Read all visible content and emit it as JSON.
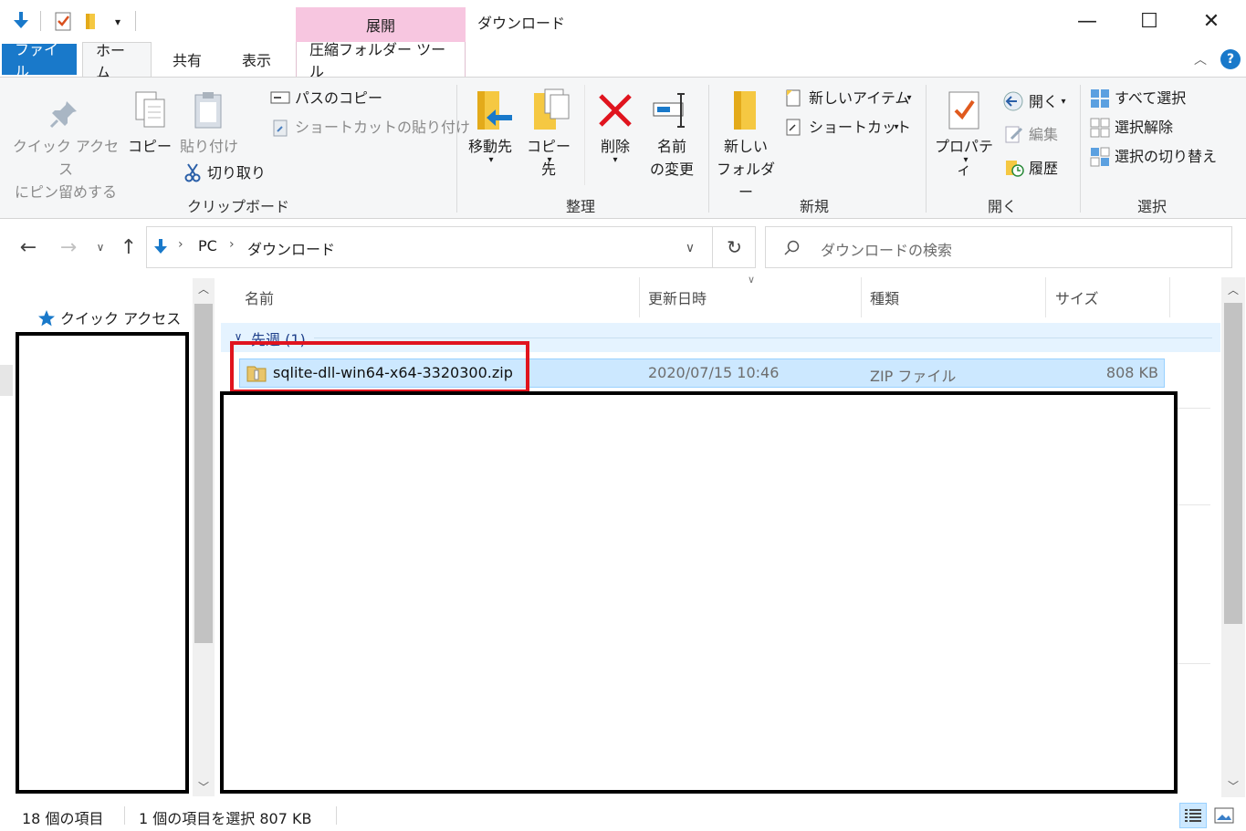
{
  "window": {
    "title": "ダウンロード",
    "context_group": "展開",
    "controls": {
      "minimize": "—",
      "maximize": "☐",
      "close": "✕"
    }
  },
  "tabs": {
    "file": "ファイル",
    "home": "ホーム",
    "share": "共有",
    "view": "表示",
    "extract": "圧縮フォルダー ツール"
  },
  "ribbon": {
    "clipboard": {
      "pin": "クイック アクセス\nにピン留めする",
      "copy": "コピー",
      "paste": "貼り付け",
      "copy_path": "パスのコピー",
      "paste_shortcut": "ショートカットの貼り付け",
      "cut": "切り取り",
      "label": "クリップボード"
    },
    "organize": {
      "move_to": "移動先",
      "copy_to": "コピー先",
      "delete": "削除",
      "rename": "名前\nの変更",
      "label": "整理"
    },
    "new": {
      "new_folder": "新しい\nフォルダー",
      "new_item": "新しいアイテム",
      "easy_access": "ショートカット",
      "label": "新規"
    },
    "open": {
      "properties": "プロパティ",
      "open": "開く",
      "edit": "編集",
      "history": "履歴",
      "label": "開く"
    },
    "select": {
      "select_all": "すべて選択",
      "select_none": "選択解除",
      "invert": "選択の切り替え",
      "label": "選択"
    }
  },
  "address": {
    "path": [
      "PC",
      "ダウンロード"
    ],
    "search_placeholder": "ダウンロードの検索"
  },
  "navpane": {
    "quick_access": "クイック アクセス"
  },
  "columns": {
    "name": "名前",
    "date": "更新日時",
    "type": "種類",
    "size": "サイズ"
  },
  "groups": [
    {
      "header": "先週 (1)",
      "files": [
        {
          "name": "sqlite-dll-win64-x64-3320300.zip",
          "date": "2020/07/15 10:46",
          "type": "ZIP ファイル",
          "size": "808 KB"
        }
      ]
    }
  ],
  "status": {
    "count": "18 個の項目",
    "selected": "1 個の項目を選択  807 KB"
  },
  "colors": {
    "accent": "#1979ca",
    "selection": "#cce8ff",
    "highlight_box": "#e0141e",
    "context_tab": "#f7c6e0"
  }
}
